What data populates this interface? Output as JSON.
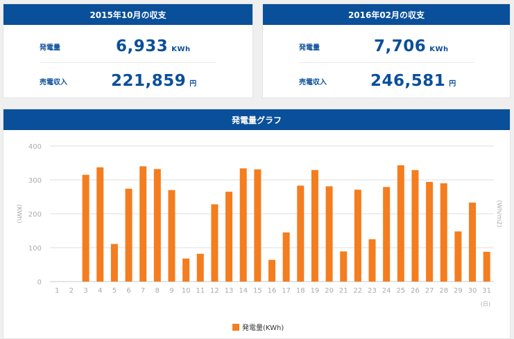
{
  "cards": [
    {
      "title": "2015年10月の収支",
      "gen_label": "発電量",
      "gen_value": "6,933",
      "gen_unit": "KWh",
      "income_label": "売電収入",
      "income_value": "221,859",
      "income_unit": "円"
    },
    {
      "title": "2016年02月の収支",
      "gen_label": "発電量",
      "gen_value": "7,706",
      "gen_unit": "KWh",
      "income_label": "売電収入",
      "income_value": "246,581",
      "income_unit": "円"
    }
  ],
  "chart_panel": {
    "title": "発電量グラフ"
  },
  "chart_data": {
    "type": "bar",
    "categories": [
      "1",
      "2",
      "3",
      "4",
      "5",
      "6",
      "7",
      "8",
      "9",
      "10",
      "11",
      "12",
      "13",
      "14",
      "15",
      "16",
      "17",
      "18",
      "19",
      "20",
      "21",
      "22",
      "23",
      "24",
      "25",
      "26",
      "27",
      "28",
      "29",
      "30",
      "31"
    ],
    "series": [
      {
        "name": "発電量(KWh)",
        "values": [
          0,
          0,
          315,
          337,
          111,
          274,
          340,
          332,
          270,
          68,
          82,
          228,
          265,
          334,
          331,
          64,
          145,
          283,
          329,
          281,
          89,
          271,
          125,
          279,
          343,
          329,
          294,
          290,
          148,
          233,
          88
        ]
      }
    ],
    "ylim": [
      0,
      400
    ],
    "yticks": [
      "0",
      "100",
      "200",
      "300",
      "400"
    ],
    "ylabel_left": "(KWh)",
    "ylabel_right": "(Wh/m2)",
    "xunit": "(日)",
    "grid": true,
    "legend_position": "bottom-center",
    "bar_color": "#f47d1f"
  }
}
